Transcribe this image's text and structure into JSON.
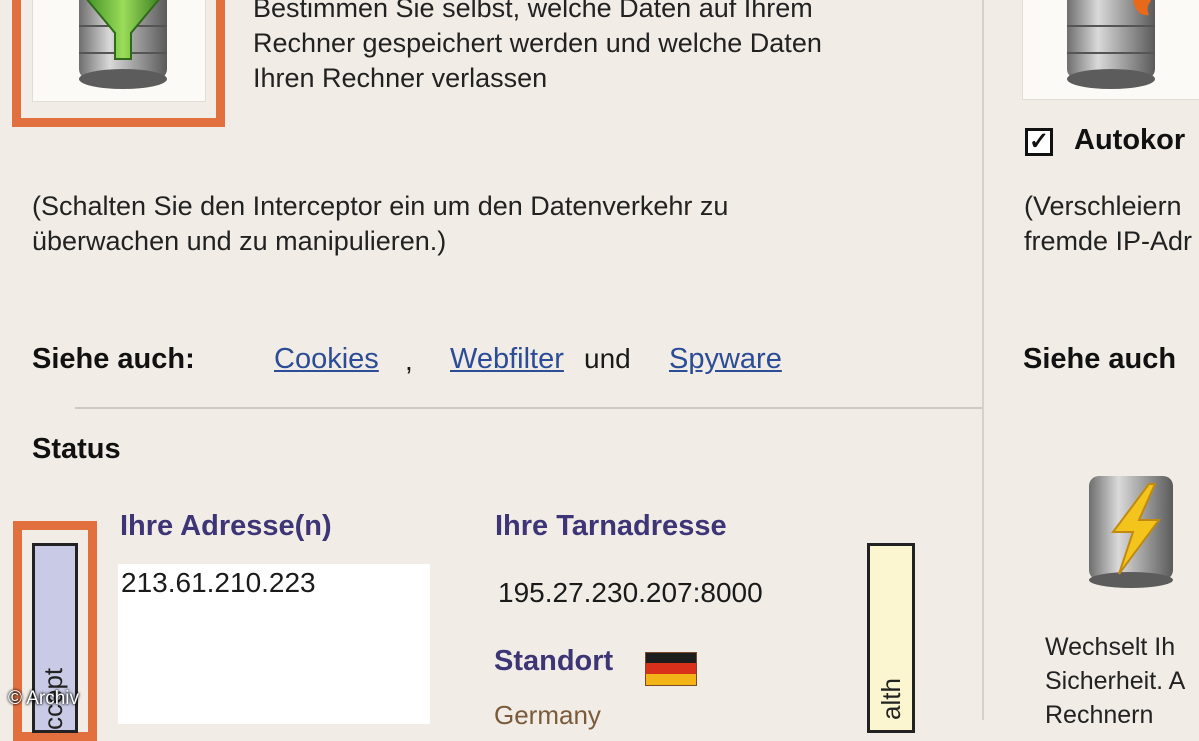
{
  "interceptor": {
    "description_lines": [
      "Bestimmen Sie selbst, welche Daten auf Ihrem",
      "Rechner gespeichert werden und welche Daten",
      "Ihren Rechner verlassen"
    ],
    "hint_lines": [
      "(Schalten Sie den Interceptor ein um den Datenverkehr zu",
      "überwachen und zu manipulieren.)"
    ],
    "see_also_label": "Siehe auch:",
    "links": [
      "Cookies",
      "Webfilter",
      "Spyware"
    ],
    "separator_comma": ",",
    "separator_and": "und"
  },
  "status": {
    "title": "Status",
    "your_address_heading": "Ihre Adresse(n)",
    "your_address_value": "213.61.210.223",
    "stealth_heading": "Ihre Tarnadresse",
    "stealth_value": "195.27.230.207:8000",
    "location_heading": "Standort",
    "location_value": "Germany",
    "left_bar_label": "ccept",
    "right_bar_label": "alth"
  },
  "right_panel": {
    "autoconnect_label": "Autokor",
    "autoconnect_checked": "✓",
    "hint_lines": [
      "(Verschleiern",
      "fremde IP-Adr"
    ],
    "see_also_label": "Siehe auch",
    "switch_lines": [
      "Wechselt Ih",
      "Sicherheit. A",
      "Rechnern"
    ]
  },
  "watermark": "© Archiv",
  "colors": {
    "background": "#f1ede6",
    "highlight_orange": "#e2703f",
    "link_blue": "#2b4c96",
    "heading_purple": "#3d3576",
    "left_bar_fill": "#c9cbe6",
    "right_bar_fill": "#fbf6cf"
  },
  "icons": [
    "funnel-database-icon",
    "fire-database-icon",
    "lightning-database-icon",
    "germany-flag-icon"
  ]
}
